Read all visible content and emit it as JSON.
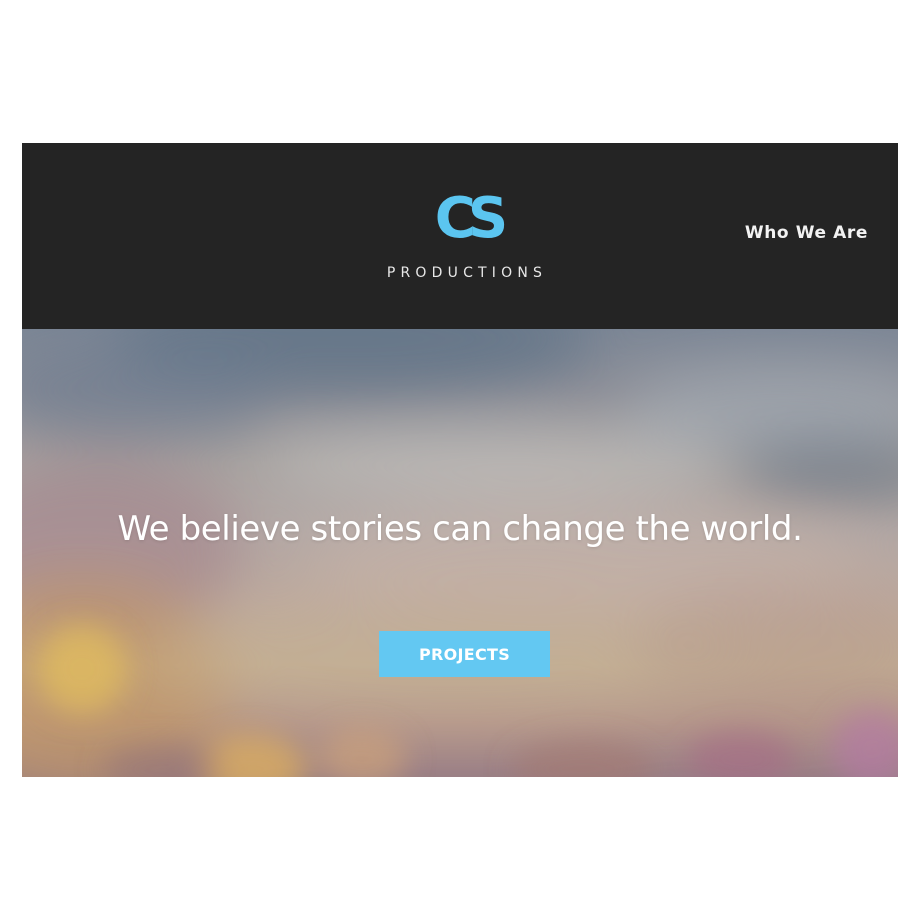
{
  "brand": {
    "logo_text": "CS",
    "tagline": "PRODUCTIONS",
    "accent_color": "#5bc5f0"
  },
  "nav": {
    "items": [
      {
        "label": "Who We Are"
      }
    ]
  },
  "hero": {
    "headline": "We believe stories can change the world.",
    "cta_label": "PROJECTS",
    "cta_color": "#63c8f2"
  },
  "colors": {
    "header_bg": "#242424",
    "page_bg": "#ffffff"
  }
}
